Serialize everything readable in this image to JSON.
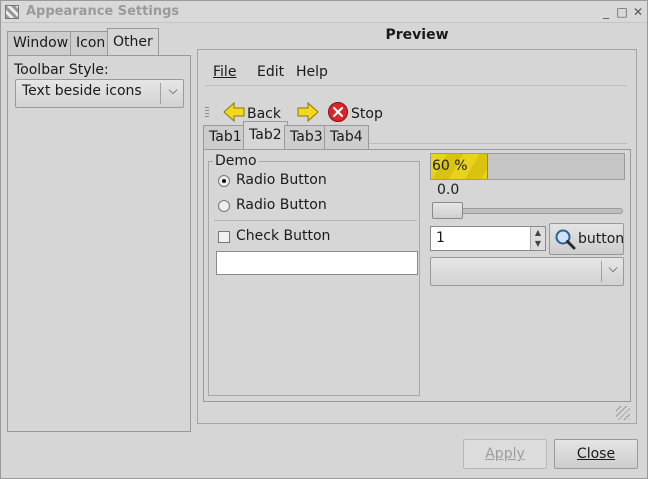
{
  "window": {
    "title": "Appearance Settings",
    "minimize": "_",
    "maximize": "□",
    "close": "✕"
  },
  "left_tabs": [
    "Window",
    "Icon",
    "Other"
  ],
  "left_tabs_active": 2,
  "toolbar_style": {
    "label": "Toolbar Style:",
    "value": "Text beside icons"
  },
  "preview": {
    "title": "Preview",
    "menu": [
      "File",
      "Edit",
      "Help"
    ],
    "toolbar": {
      "back": "Back",
      "stop": "Stop"
    },
    "tabs": [
      "Tab1",
      "Tab2",
      "Tab3",
      "Tab4"
    ],
    "tabs_active": 1,
    "demo": {
      "title": "Demo",
      "radio1": "Radio Button",
      "radio2": "Radio Button",
      "check": "Check Button",
      "entry_value": ""
    },
    "progress": {
      "percent": 60,
      "label": "60 %"
    },
    "slider": {
      "value_label": "0.0",
      "value": 0.0
    },
    "spin": {
      "value": "1"
    },
    "search_button": "button",
    "combo_value": ""
  },
  "buttons": {
    "apply": "Apply",
    "close": "Close"
  },
  "colors": {
    "progress_fill": "#e8d21c",
    "stop_icon": "#d8262b",
    "arrow_yellow": "#f4d81c"
  }
}
